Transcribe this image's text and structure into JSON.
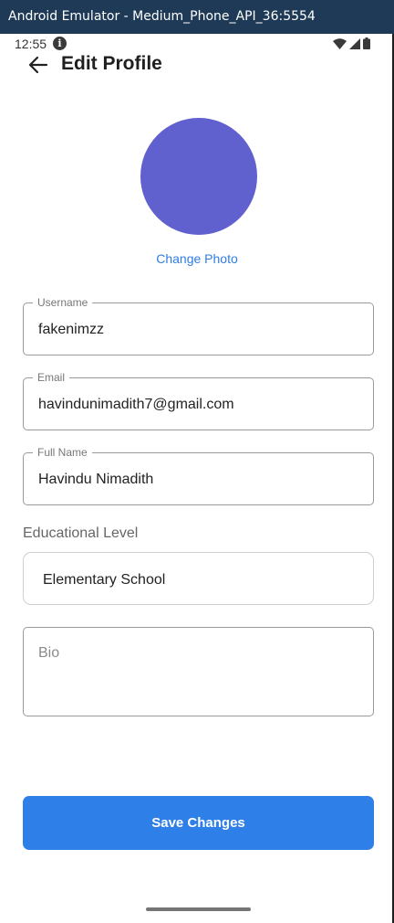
{
  "window": {
    "title": "Android Emulator - Medium_Phone_API_36:5554"
  },
  "status_bar": {
    "time": "12:55",
    "icons": [
      "info-icon",
      "wifi-icon",
      "signal-icon",
      "battery-icon"
    ]
  },
  "header": {
    "title": "Edit Profile",
    "back_icon": "arrow-left-icon"
  },
  "profile": {
    "avatar_color": "#6160cf",
    "change_photo_label": "Change Photo"
  },
  "form": {
    "username": {
      "label": "Username",
      "value": "fakenimzz"
    },
    "email": {
      "label": "Email",
      "value": "havindunimadith7@gmail.com"
    },
    "full_name": {
      "label": "Full Name",
      "value": "Havindu Nimadith"
    },
    "educational_level": {
      "label": "Educational Level",
      "selected": "Elementary School"
    },
    "bio": {
      "placeholder": "Bio",
      "value": ""
    }
  },
  "actions": {
    "save_label": "Save Changes"
  },
  "colors": {
    "accent": "#2f7fe9",
    "link": "#2f7ee4",
    "titlebar": "#1f3a57"
  }
}
